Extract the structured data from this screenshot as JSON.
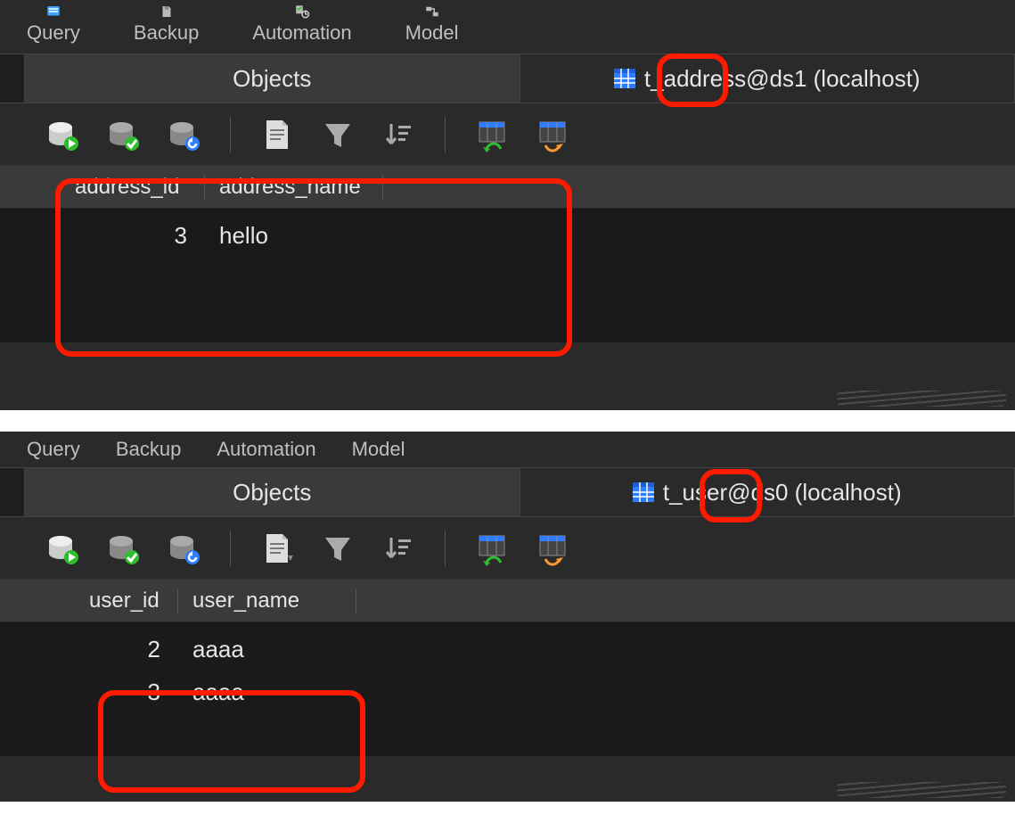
{
  "panel1": {
    "menu": {
      "query": "Query",
      "backup": "Backup",
      "automation": "Automation",
      "model": "Model"
    },
    "tabs": {
      "objects": "Objects",
      "table_name": "t_address@ds1 (localhost)"
    },
    "columns": {
      "c1": "address_id",
      "c2": "address_name"
    },
    "rows": [
      {
        "id": "3",
        "name": "hello"
      }
    ]
  },
  "panel2": {
    "menu": {
      "query": "Query",
      "backup": "Backup",
      "automation": "Automation",
      "model": "Model"
    },
    "tabs": {
      "objects": "Objects",
      "table_name": "t_user@ds0 (localhost)"
    },
    "columns": {
      "c1": "user_id",
      "c2": "user_name"
    },
    "rows": [
      {
        "id": "2",
        "name": "aaaa"
      },
      {
        "id": "3",
        "name": "aaaa"
      }
    ]
  },
  "icons": {
    "query": "query-icon",
    "backup": "backup-icon",
    "automation": "automation-icon",
    "model": "model-icon",
    "run": "db-run-icon",
    "commit": "db-commit-icon",
    "rollback": "db-rollback-icon",
    "text": "text-view-icon",
    "filter": "filter-icon",
    "sort": "sort-icon",
    "import": "import-icon",
    "export": "export-icon",
    "table": "table-icon"
  }
}
